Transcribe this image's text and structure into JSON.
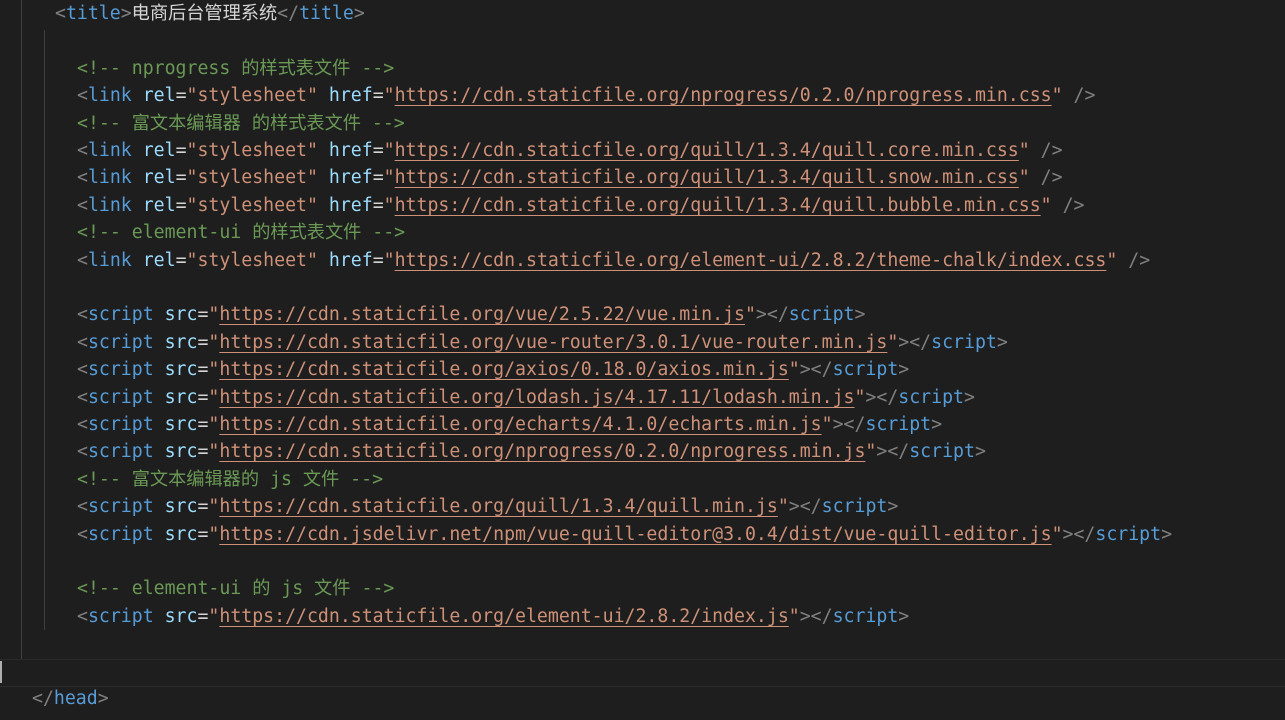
{
  "editor": {
    "language": "html",
    "theme_colors": {
      "background": "#1e1e1e",
      "tag": "#569cd6",
      "attribute": "#9cdcfe",
      "string": "#ce9178",
      "comment": "#6a9955",
      "bracket": "#808080",
      "text": "#d4d4d4"
    },
    "lines": [
      {
        "indent": 1,
        "tokens": [
          {
            "t": "bracket",
            "v": "<"
          },
          {
            "t": "tag",
            "v": "title"
          },
          {
            "t": "bracket",
            "v": ">"
          },
          {
            "t": "text",
            "v": "电商后台管理系统"
          },
          {
            "t": "bracket",
            "v": "</"
          },
          {
            "t": "tag",
            "v": "title"
          },
          {
            "t": "bracket",
            "v": ">"
          }
        ]
      },
      {
        "indent": 0,
        "tokens": []
      },
      {
        "indent": 2,
        "tokens": [
          {
            "t": "comment",
            "v": "<!-- nprogress 的样式表文件 -->"
          }
        ]
      },
      {
        "indent": 2,
        "tokens": [
          {
            "t": "bracket",
            "v": "<"
          },
          {
            "t": "tag",
            "v": "link"
          },
          {
            "t": "text",
            "v": " "
          },
          {
            "t": "attr",
            "v": "rel"
          },
          {
            "t": "eq",
            "v": "="
          },
          {
            "t": "str",
            "v": "\"stylesheet\""
          },
          {
            "t": "text",
            "v": " "
          },
          {
            "t": "attr",
            "v": "href"
          },
          {
            "t": "eq",
            "v": "="
          },
          {
            "t": "str",
            "v": "\""
          },
          {
            "t": "link",
            "v": "https://cdn.staticfile.org/nprogress/0.2.0/nprogress.min.css"
          },
          {
            "t": "str",
            "v": "\""
          },
          {
            "t": "text",
            "v": " "
          },
          {
            "t": "bracket",
            "v": "/>"
          }
        ]
      },
      {
        "indent": 2,
        "tokens": [
          {
            "t": "comment",
            "v": "<!-- 富文本编辑器 的样式表文件 -->"
          }
        ]
      },
      {
        "indent": 2,
        "tokens": [
          {
            "t": "bracket",
            "v": "<"
          },
          {
            "t": "tag",
            "v": "link"
          },
          {
            "t": "text",
            "v": " "
          },
          {
            "t": "attr",
            "v": "rel"
          },
          {
            "t": "eq",
            "v": "="
          },
          {
            "t": "str",
            "v": "\"stylesheet\""
          },
          {
            "t": "text",
            "v": " "
          },
          {
            "t": "attr",
            "v": "href"
          },
          {
            "t": "eq",
            "v": "="
          },
          {
            "t": "str",
            "v": "\""
          },
          {
            "t": "link",
            "v": "https://cdn.staticfile.org/quill/1.3.4/quill.core.min.css"
          },
          {
            "t": "str",
            "v": "\""
          },
          {
            "t": "text",
            "v": " "
          },
          {
            "t": "bracket",
            "v": "/>"
          }
        ]
      },
      {
        "indent": 2,
        "tokens": [
          {
            "t": "bracket",
            "v": "<"
          },
          {
            "t": "tag",
            "v": "link"
          },
          {
            "t": "text",
            "v": " "
          },
          {
            "t": "attr",
            "v": "rel"
          },
          {
            "t": "eq",
            "v": "="
          },
          {
            "t": "str",
            "v": "\"stylesheet\""
          },
          {
            "t": "text",
            "v": " "
          },
          {
            "t": "attr",
            "v": "href"
          },
          {
            "t": "eq",
            "v": "="
          },
          {
            "t": "str",
            "v": "\""
          },
          {
            "t": "link",
            "v": "https://cdn.staticfile.org/quill/1.3.4/quill.snow.min.css"
          },
          {
            "t": "str",
            "v": "\""
          },
          {
            "t": "text",
            "v": " "
          },
          {
            "t": "bracket",
            "v": "/>"
          }
        ]
      },
      {
        "indent": 2,
        "tokens": [
          {
            "t": "bracket",
            "v": "<"
          },
          {
            "t": "tag",
            "v": "link"
          },
          {
            "t": "text",
            "v": " "
          },
          {
            "t": "attr",
            "v": "rel"
          },
          {
            "t": "eq",
            "v": "="
          },
          {
            "t": "str",
            "v": "\"stylesheet\""
          },
          {
            "t": "text",
            "v": " "
          },
          {
            "t": "attr",
            "v": "href"
          },
          {
            "t": "eq",
            "v": "="
          },
          {
            "t": "str",
            "v": "\""
          },
          {
            "t": "link",
            "v": "https://cdn.staticfile.org/quill/1.3.4/quill.bubble.min.css"
          },
          {
            "t": "str",
            "v": "\""
          },
          {
            "t": "text",
            "v": " "
          },
          {
            "t": "bracket",
            "v": "/>"
          }
        ]
      },
      {
        "indent": 2,
        "tokens": [
          {
            "t": "comment",
            "v": "<!-- element-ui 的样式表文件 -->"
          }
        ]
      },
      {
        "indent": 2,
        "tokens": [
          {
            "t": "bracket",
            "v": "<"
          },
          {
            "t": "tag",
            "v": "link"
          },
          {
            "t": "text",
            "v": " "
          },
          {
            "t": "attr",
            "v": "rel"
          },
          {
            "t": "eq",
            "v": "="
          },
          {
            "t": "str",
            "v": "\"stylesheet\""
          },
          {
            "t": "text",
            "v": " "
          },
          {
            "t": "attr",
            "v": "href"
          },
          {
            "t": "eq",
            "v": "="
          },
          {
            "t": "str",
            "v": "\""
          },
          {
            "t": "link",
            "v": "https://cdn.staticfile.org/element-ui/2.8.2/theme-chalk/index.css"
          },
          {
            "t": "str",
            "v": "\""
          },
          {
            "t": "text",
            "v": " "
          },
          {
            "t": "bracket",
            "v": "/>"
          }
        ]
      },
      {
        "indent": 0,
        "tokens": []
      },
      {
        "indent": 2,
        "tokens": [
          {
            "t": "bracket",
            "v": "<"
          },
          {
            "t": "tag",
            "v": "script"
          },
          {
            "t": "text",
            "v": " "
          },
          {
            "t": "attr",
            "v": "src"
          },
          {
            "t": "eq",
            "v": "="
          },
          {
            "t": "str",
            "v": "\""
          },
          {
            "t": "link",
            "v": "https://cdn.staticfile.org/vue/2.5.22/vue.min.js"
          },
          {
            "t": "str",
            "v": "\""
          },
          {
            "t": "bracket",
            "v": "></"
          },
          {
            "t": "tag",
            "v": "script"
          },
          {
            "t": "bracket",
            "v": ">"
          }
        ]
      },
      {
        "indent": 2,
        "tokens": [
          {
            "t": "bracket",
            "v": "<"
          },
          {
            "t": "tag",
            "v": "script"
          },
          {
            "t": "text",
            "v": " "
          },
          {
            "t": "attr",
            "v": "src"
          },
          {
            "t": "eq",
            "v": "="
          },
          {
            "t": "str",
            "v": "\""
          },
          {
            "t": "link",
            "v": "https://cdn.staticfile.org/vue-router/3.0.1/vue-router.min.js"
          },
          {
            "t": "str",
            "v": "\""
          },
          {
            "t": "bracket",
            "v": "></"
          },
          {
            "t": "tag",
            "v": "script"
          },
          {
            "t": "bracket",
            "v": ">"
          }
        ]
      },
      {
        "indent": 2,
        "tokens": [
          {
            "t": "bracket",
            "v": "<"
          },
          {
            "t": "tag",
            "v": "script"
          },
          {
            "t": "text",
            "v": " "
          },
          {
            "t": "attr",
            "v": "src"
          },
          {
            "t": "eq",
            "v": "="
          },
          {
            "t": "str",
            "v": "\""
          },
          {
            "t": "link",
            "v": "https://cdn.staticfile.org/axios/0.18.0/axios.min.js"
          },
          {
            "t": "str",
            "v": "\""
          },
          {
            "t": "bracket",
            "v": "></"
          },
          {
            "t": "tag",
            "v": "script"
          },
          {
            "t": "bracket",
            "v": ">"
          }
        ]
      },
      {
        "indent": 2,
        "tokens": [
          {
            "t": "bracket",
            "v": "<"
          },
          {
            "t": "tag",
            "v": "script"
          },
          {
            "t": "text",
            "v": " "
          },
          {
            "t": "attr",
            "v": "src"
          },
          {
            "t": "eq",
            "v": "="
          },
          {
            "t": "str",
            "v": "\""
          },
          {
            "t": "link",
            "v": "https://cdn.staticfile.org/lodash.js/4.17.11/lodash.min.js"
          },
          {
            "t": "str",
            "v": "\""
          },
          {
            "t": "bracket",
            "v": "></"
          },
          {
            "t": "tag",
            "v": "script"
          },
          {
            "t": "bracket",
            "v": ">"
          }
        ]
      },
      {
        "indent": 2,
        "tokens": [
          {
            "t": "bracket",
            "v": "<"
          },
          {
            "t": "tag",
            "v": "script"
          },
          {
            "t": "text",
            "v": " "
          },
          {
            "t": "attr",
            "v": "src"
          },
          {
            "t": "eq",
            "v": "="
          },
          {
            "t": "str",
            "v": "\""
          },
          {
            "t": "link",
            "v": "https://cdn.staticfile.org/echarts/4.1.0/echarts.min.js"
          },
          {
            "t": "str",
            "v": "\""
          },
          {
            "t": "bracket",
            "v": "></"
          },
          {
            "t": "tag",
            "v": "script"
          },
          {
            "t": "bracket",
            "v": ">"
          }
        ]
      },
      {
        "indent": 2,
        "tokens": [
          {
            "t": "bracket",
            "v": "<"
          },
          {
            "t": "tag",
            "v": "script"
          },
          {
            "t": "text",
            "v": " "
          },
          {
            "t": "attr",
            "v": "src"
          },
          {
            "t": "eq",
            "v": "="
          },
          {
            "t": "str",
            "v": "\""
          },
          {
            "t": "link",
            "v": "https://cdn.staticfile.org/nprogress/0.2.0/nprogress.min.js"
          },
          {
            "t": "str",
            "v": "\""
          },
          {
            "t": "bracket",
            "v": "></"
          },
          {
            "t": "tag",
            "v": "script"
          },
          {
            "t": "bracket",
            "v": ">"
          }
        ]
      },
      {
        "indent": 2,
        "tokens": [
          {
            "t": "comment",
            "v": "<!-- 富文本编辑器的 js 文件 -->"
          }
        ]
      },
      {
        "indent": 2,
        "tokens": [
          {
            "t": "bracket",
            "v": "<"
          },
          {
            "t": "tag",
            "v": "script"
          },
          {
            "t": "text",
            "v": " "
          },
          {
            "t": "attr",
            "v": "src"
          },
          {
            "t": "eq",
            "v": "="
          },
          {
            "t": "str",
            "v": "\""
          },
          {
            "t": "link",
            "v": "https://cdn.staticfile.org/quill/1.3.4/quill.min.js"
          },
          {
            "t": "str",
            "v": "\""
          },
          {
            "t": "bracket",
            "v": "></"
          },
          {
            "t": "tag",
            "v": "script"
          },
          {
            "t": "bracket",
            "v": ">"
          }
        ]
      },
      {
        "indent": 2,
        "tokens": [
          {
            "t": "bracket",
            "v": "<"
          },
          {
            "t": "tag",
            "v": "script"
          },
          {
            "t": "text",
            "v": " "
          },
          {
            "t": "attr",
            "v": "src"
          },
          {
            "t": "eq",
            "v": "="
          },
          {
            "t": "str",
            "v": "\""
          },
          {
            "t": "link",
            "v": "https://cdn.jsdelivr.net/npm/vue-quill-editor@3.0.4/dist/vue-quill-editor.js"
          },
          {
            "t": "str",
            "v": "\""
          },
          {
            "t": "bracket",
            "v": "></"
          },
          {
            "t": "tag",
            "v": "script"
          },
          {
            "t": "bracket",
            "v": ">"
          }
        ]
      },
      {
        "indent": 0,
        "tokens": []
      },
      {
        "indent": 2,
        "tokens": [
          {
            "t": "comment",
            "v": "<!-- element-ui 的 js 文件 -->"
          }
        ]
      },
      {
        "indent": 2,
        "tokens": [
          {
            "t": "bracket",
            "v": "<"
          },
          {
            "t": "tag",
            "v": "script"
          },
          {
            "t": "text",
            "v": " "
          },
          {
            "t": "attr",
            "v": "src"
          },
          {
            "t": "eq",
            "v": "="
          },
          {
            "t": "str",
            "v": "\""
          },
          {
            "t": "link",
            "v": "https://cdn.staticfile.org/element-ui/2.8.2/index.js"
          },
          {
            "t": "str",
            "v": "\""
          },
          {
            "t": "bracket",
            "v": "></"
          },
          {
            "t": "tag",
            "v": "script"
          },
          {
            "t": "bracket",
            "v": ">"
          }
        ]
      },
      {
        "indent": 0,
        "tokens": []
      },
      {
        "indent": 0,
        "tokens": []
      },
      {
        "indent": 0,
        "tokens": [
          {
            "t": "bracket",
            "v": "</"
          },
          {
            "t": "tag",
            "v": "head"
          },
          {
            "t": "bracket",
            "v": ">"
          }
        ]
      }
    ]
  }
}
